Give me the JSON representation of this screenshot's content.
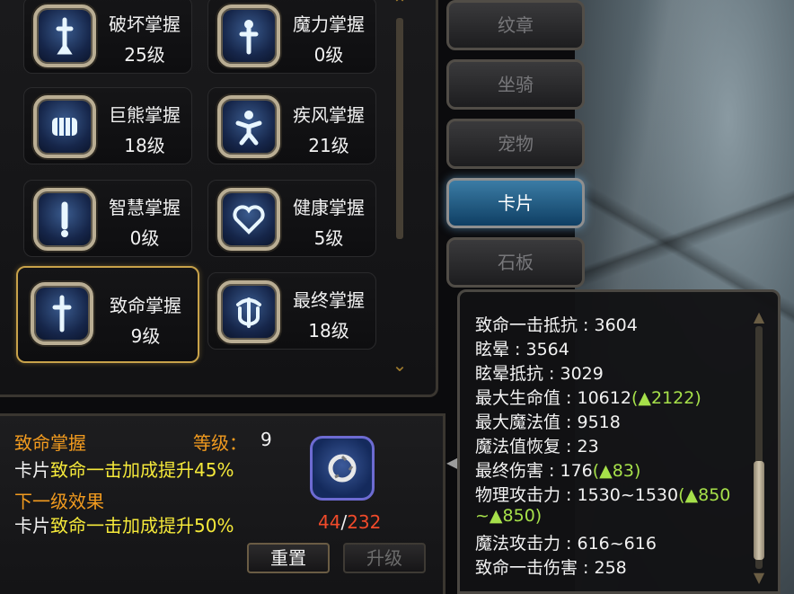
{
  "skills": [
    {
      "name": "破坏掌握",
      "level": "25级",
      "icon": "sword-icon"
    },
    {
      "name": "魔力掌握",
      "level": "0级",
      "icon": "staff-icon"
    },
    {
      "name": "巨熊掌握",
      "level": "18级",
      "icon": "fist-icon"
    },
    {
      "name": "疾风掌握",
      "level": "21级",
      "icon": "running-figure-icon"
    },
    {
      "name": "智慧掌握",
      "level": "0级",
      "icon": "exclamation-icon"
    },
    {
      "name": "健康掌握",
      "level": "5级",
      "icon": "heart-icon"
    },
    {
      "name": "致命掌握",
      "level": "9级",
      "icon": "dagger-icon"
    },
    {
      "name": "最终掌握",
      "level": "18级",
      "icon": "crest-icon"
    }
  ],
  "selected_skill": "致命掌握",
  "detail": {
    "title": "致命掌握",
    "level_label": "等级：",
    "level_value": "9",
    "current_prefix": "卡片",
    "current_effect": "致命一击加成提升45%",
    "next_title": "下一级效果",
    "next_prefix": "卡片",
    "next_effect": "致命一击加成提升50%",
    "progress_current": "44",
    "progress_sep": "/",
    "progress_total": "232",
    "reset_label": "重置",
    "upgrade_label": "升级"
  },
  "tabs": [
    {
      "label": "纹章",
      "active": false
    },
    {
      "label": "坐骑",
      "active": false
    },
    {
      "label": "宠物",
      "active": false
    },
    {
      "label": "卡片",
      "active": true
    },
    {
      "label": "石板",
      "active": false
    }
  ],
  "stats": [
    {
      "label": "致命一击抵抗 : 3604",
      "bonus": ""
    },
    {
      "label": "眩晕 : 3564",
      "bonus": ""
    },
    {
      "label": "眩晕抵抗 : 3029",
      "bonus": ""
    },
    {
      "label": "最大生命值 :  10612",
      "bonus": "(▲2122)"
    },
    {
      "label": "最大魔法值 :  9518",
      "bonus": ""
    },
    {
      "label": "魔法值恢复 : 23",
      "bonus": ""
    },
    {
      "label": "最终伤害 : 176",
      "bonus": "(▲83)"
    },
    {
      "label": "物理攻击力 : 1530~1530",
      "bonus": "(▲850"
    },
    {
      "label": "",
      "bonus": "~▲850)"
    },
    {
      "label": "魔法攻击力 : 616~616",
      "bonus": ""
    },
    {
      "label": "致命一击伤害 : 258",
      "bonus": ""
    }
  ],
  "colors": {
    "accent_orange": "#f29b1f",
    "effect_yellow": "#f5e93a",
    "bonus_green": "#a6e04a",
    "progress_red": "#f04a2a",
    "active_tab": "#3b7ca5"
  }
}
